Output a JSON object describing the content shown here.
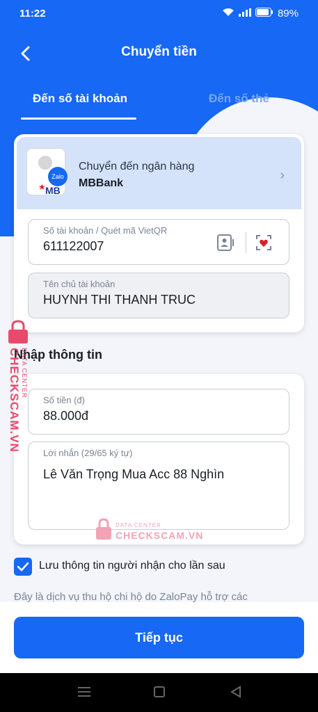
{
  "status_bar": {
    "time": "11:22",
    "battery": "89%"
  },
  "header": {
    "title": "Chuyển tiền"
  },
  "tabs": [
    {
      "label": "Đến số tài khoản",
      "active": true
    },
    {
      "label": "Đến số thẻ",
      "active": false
    }
  ],
  "bank": {
    "subtitle": "Chuyển đến ngân hàng",
    "name": "MBBank",
    "badge": "Zalo",
    "logo_text": "MB"
  },
  "account_field": {
    "label": "Số tài khoản / Quét mã VietQR",
    "value": "611122007"
  },
  "name_field": {
    "label": "Tên chủ tài khoản",
    "value": "HUYNH THI THANH TRUC"
  },
  "section_title": "Nhập thông tin",
  "amount_field": {
    "label": "Số tiền (đ)",
    "value": "88.000đ"
  },
  "message_field": {
    "label": "Lời nhắn (29/65 ký tự)",
    "value": "Lê Văn Trọng Mua Acc 88 Nghìn"
  },
  "save_checkbox": {
    "label": "Lưu thông tin người nhận cho lần sau",
    "checked": true
  },
  "disclaimer": "Đây là dịch vụ thu hộ chi hộ do ZaloPay hỗ trợ các",
  "continue_button": "Tiếp tục",
  "watermark": {
    "small": "DATA CENTER",
    "big": "CHECKSCAM.VN"
  },
  "colors": {
    "primary": "#1668f5",
    "watermark": "#e94a6b"
  }
}
